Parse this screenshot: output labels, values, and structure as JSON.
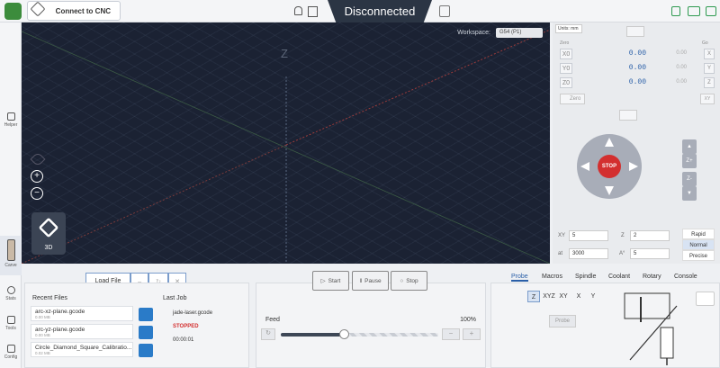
{
  "topbar": {
    "connect_label": "Connect to CNC",
    "status": "Disconnected"
  },
  "sidebar": {
    "items": [
      {
        "label": "Helper",
        "icon": "bulb-icon"
      },
      {
        "label": "Carve",
        "icon": "carve-icon"
      },
      {
        "label": "Stats",
        "icon": "gauge-icon"
      },
      {
        "label": "Tools",
        "icon": "wrench-icon"
      },
      {
        "label": "Config",
        "icon": "sliders-icon"
      }
    ]
  },
  "viewer": {
    "workspace_label": "Workspace:",
    "workspace_value": "G54 (P1)",
    "axis_label": "Z",
    "view_label": "3D"
  },
  "dro": {
    "units_label": "Units: mm",
    "zero_header": "Zero",
    "go_header": "Go",
    "axes": [
      {
        "name": "X0",
        "value": "0.00",
        "machine": "0.00",
        "go": "X"
      },
      {
        "name": "Y0",
        "value": "0.00",
        "machine": "0.00",
        "go": "Y"
      },
      {
        "name": "Z0",
        "value": "0.00",
        "machine": "0.00",
        "go": "Z"
      }
    ],
    "zero_all_label": "Zero",
    "go_xy_label": "XY",
    "stop_label": "STOP",
    "jog_labels": {
      "xminus": "X-",
      "xplus": "X+",
      "yplus": "Y+",
      "yminus": "Y-",
      "zplus": "Z+",
      "zminus": "Z-"
    },
    "fields": {
      "xy_label": "XY",
      "xy_value": "5",
      "z_label": "Z",
      "z_value": "2",
      "at_label": "at",
      "at_value": "3000",
      "a_label": "A°",
      "a_value": "5"
    },
    "speeds": [
      "Rapid",
      "Normal",
      "Precise"
    ],
    "selected_speed": "Normal"
  },
  "files": {
    "load_label": "Load File",
    "recent_header": "Recent Files",
    "recent": [
      {
        "name": "arc-xz-plane.gcode",
        "size": "0.00 MB"
      },
      {
        "name": "arc-yz-plane.gcode",
        "size": "0.00 MB"
      },
      {
        "name": "Circle_Diamond_Square_Calibratio...",
        "size": "0.02 MB"
      }
    ],
    "last_job_header": "Last Job",
    "last_job_file": "jade-laser.gcode",
    "last_job_status": "STOPPED",
    "last_job_time": "00:00:01"
  },
  "job": {
    "start_label": "Start",
    "pause_label": "Pause",
    "stop_label": "Stop",
    "feed_label": "Feed",
    "feed_value": "100%",
    "feed_fraction": 0.4
  },
  "tools_panel": {
    "tabs": [
      "Probe",
      "Macros",
      "Spindle",
      "Coolant",
      "Rotary",
      "Console"
    ],
    "active_tab": "Probe",
    "probe_axes": [
      "Z",
      "XYZ",
      "XY",
      "X",
      "Y"
    ],
    "selected_axis": "Z",
    "probe_button": "Probe"
  }
}
